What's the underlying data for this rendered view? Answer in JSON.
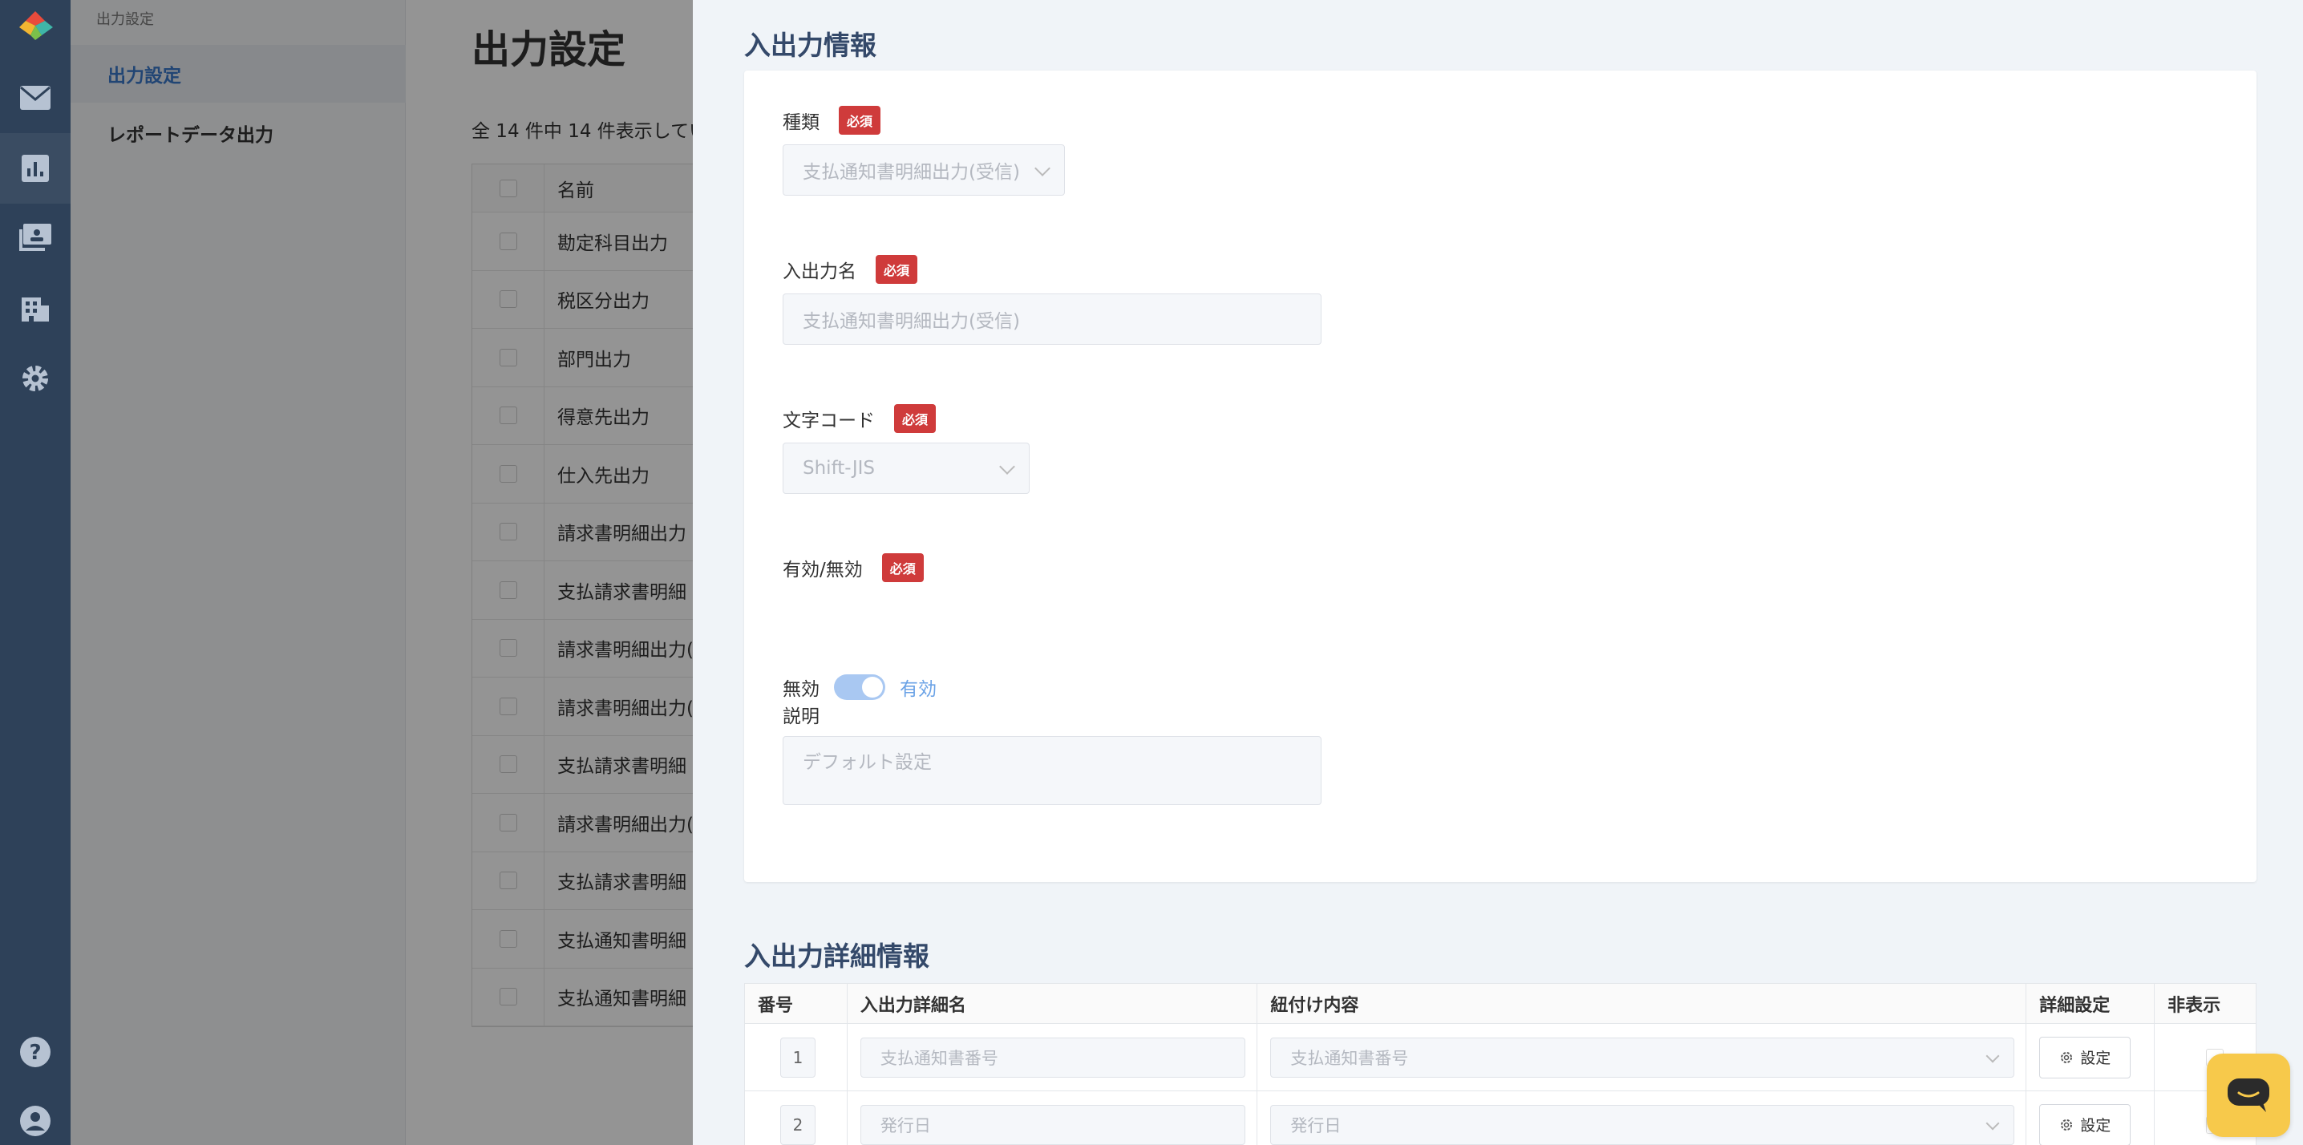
{
  "subnav": {
    "crumb": "出力設定",
    "items": [
      {
        "label": "出力設定"
      },
      {
        "label": "レポートデータ出力"
      }
    ]
  },
  "main": {
    "title": "出力設定",
    "count": "全 14 件中 14 件表示してい",
    "column_name": "名前",
    "rows": [
      "勘定科目出力",
      "税区分出力",
      "部門出力",
      "得意先出力",
      "仕入先出力",
      "請求書明細出力",
      "支払請求書明細",
      "請求書明細出力(",
      "請求書明細出力(",
      "支払請求書明細",
      "請求書明細出力(",
      "支払請求書明細",
      "支払通知書明細",
      "支払通知書明細"
    ]
  },
  "drawer": {
    "section1_title": "入出力情報",
    "required": "必須",
    "fields": {
      "type_label": "種類",
      "type_value": "支払通知書明細出力(受信)",
      "name_label": "入出力名",
      "name_value": "支払通知書明細出力(受信)",
      "charset_label": "文字コード",
      "charset_value": "Shift-JIS",
      "enabled_label": "有効/無効",
      "off_label": "無効",
      "on_label": "有効",
      "desc_label": "説明",
      "desc_placeholder": "デフォルト設定"
    },
    "section2_title": "入出力詳細情報",
    "detail_headers": [
      "番号",
      "入出力詳細名",
      "紐付け内容",
      "詳細設定",
      "非表示"
    ],
    "detail_rows": [
      {
        "no": "1",
        "name": "支払通知書番号",
        "link": "支払通知書番号",
        "btn": "設定"
      },
      {
        "no": "2",
        "name": "発行日",
        "link": "発行日",
        "btn": "設定"
      }
    ]
  },
  "colors": {
    "rail": "#2e4159",
    "accent": "#3a78c9",
    "required": "#cf3b3b",
    "chat": "#f7c94b"
  }
}
